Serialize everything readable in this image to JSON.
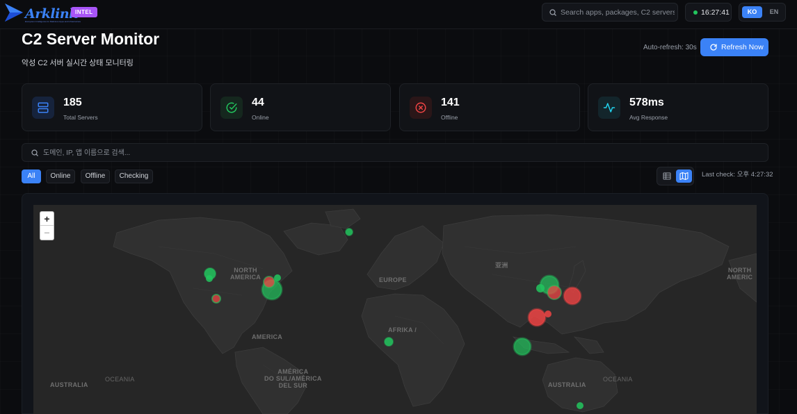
{
  "brand": {
    "name": "Arklink",
    "tagline": "Ecosystem Intelligence for Malicious Apps and Infrastructure",
    "badge": "INTEL",
    "color": "#3b82f6"
  },
  "topbar": {
    "search_placeholder": "Search apps, packages, C2 servers...",
    "clock": "16:27:41",
    "lang": {
      "ko": "KO",
      "en": "EN",
      "active": "KO"
    }
  },
  "header": {
    "title": "C2 Server Monitor",
    "subtitle": "악성 C2 서버 실시간 상태 모니터링",
    "auto_refresh": "Auto-refresh: 30s",
    "refresh_label": "Refresh Now"
  },
  "stats": [
    {
      "value": "185",
      "label": "Total Servers",
      "icon": "server-icon",
      "color": "#3b82f6"
    },
    {
      "value": "44",
      "label": "Online",
      "icon": "check-circle-icon",
      "color": "#22c55e"
    },
    {
      "value": "141",
      "label": "Offline",
      "icon": "x-circle-icon",
      "color": "#ef4444"
    },
    {
      "value": "578ms",
      "label": "Avg Response",
      "icon": "activity-icon",
      "color": "#22d3ee"
    }
  ],
  "search": {
    "placeholder": "도메인, IP, 앱 이름으로 검색..."
  },
  "filters": [
    {
      "label": "All",
      "active": true
    },
    {
      "label": "Online",
      "active": false
    },
    {
      "label": "Offline",
      "active": false
    },
    {
      "label": "Checking",
      "active": false
    }
  ],
  "view": {
    "active": "map"
  },
  "last_check": "Last check: 오후 4:27:32",
  "map": {
    "zoom_in": "+",
    "zoom_out": "−",
    "labels": {
      "north_america": "NORTH\nAMERICA",
      "north_america_east": "NORTH\nAMERIC",
      "europe": "EUROPE",
      "asia": "亚洲",
      "africa": "AFRIKA /",
      "america": "AMERICA",
      "south_america": "AMÉRICA\nDO SUL/AMÉRICA\nDEL SUR",
      "australia_w": "AUSTRALIA",
      "oceania_w": "OCEANIA",
      "australia_e": "AUSTRALIA",
      "oceania_e": "OCEANIA"
    },
    "colors": {
      "online": "#22c55e",
      "offline": "#ef4444"
    }
  }
}
